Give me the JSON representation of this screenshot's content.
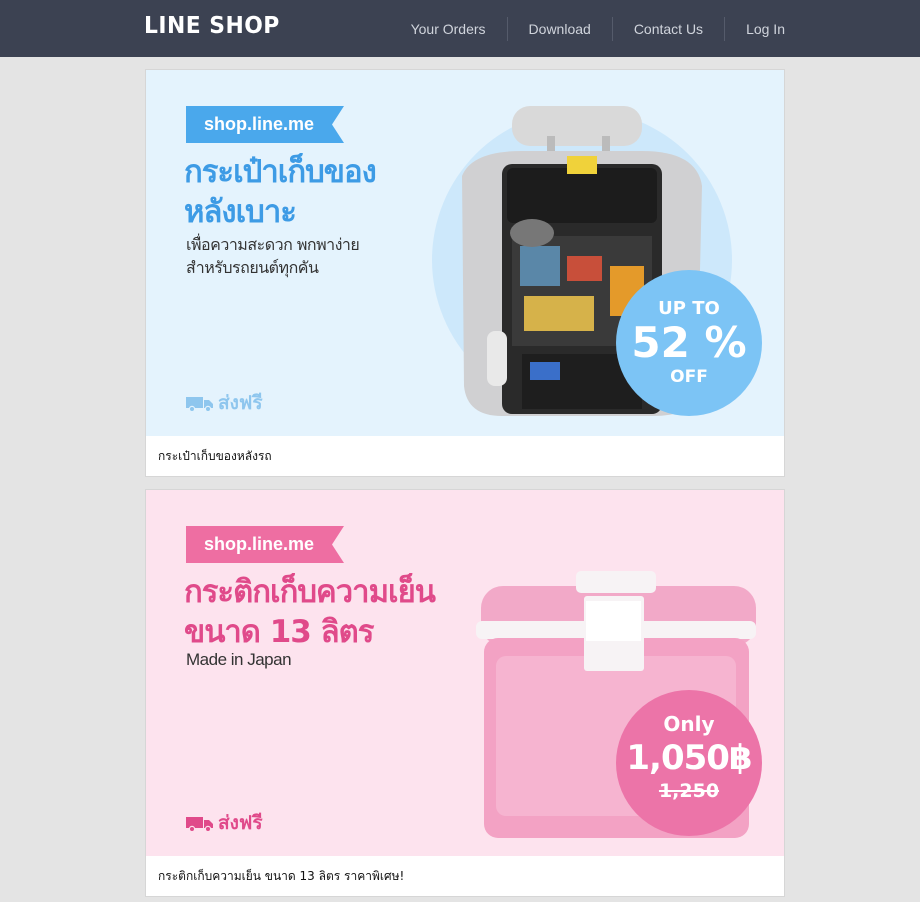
{
  "header": {
    "logo": "LINE SHOP",
    "nav": [
      "Your Orders",
      "Download",
      "Contact Us",
      "Log In"
    ]
  },
  "products": [
    {
      "tag": "shop.line.me",
      "headline_line1": "กระเป๋าเก็บของ",
      "headline_line2": "หลังเบาะ",
      "sub_line1": "เพื่อความสะดวก พกพาง่าย",
      "sub_line2": "สำหรับรถยนต์ทุกคัน",
      "shipping": "ส่งฟรี",
      "badge_top": "UP TO",
      "badge_main": "52 %",
      "badge_bottom": "OFF",
      "caption": "กระเป๋าเก็บของหลังรถ",
      "accent": "#4aa8ec",
      "bg": "#e4f3fd"
    },
    {
      "tag": "shop.line.me",
      "headline_line1": "กระติกเก็บความเย็น",
      "headline_line2": "ขนาด 13 ลิตร",
      "sub_line1": "Made in Japan",
      "shipping": "ส่งฟรี",
      "badge_top": "Only",
      "badge_main": "1,050฿",
      "badge_bottom": "1,250",
      "caption": "กระติกเก็บความเย็น ขนาด 13 ลิตร ราคาพิเศษ!",
      "accent": "#e04a8a",
      "bg": "#fde3ee"
    }
  ]
}
